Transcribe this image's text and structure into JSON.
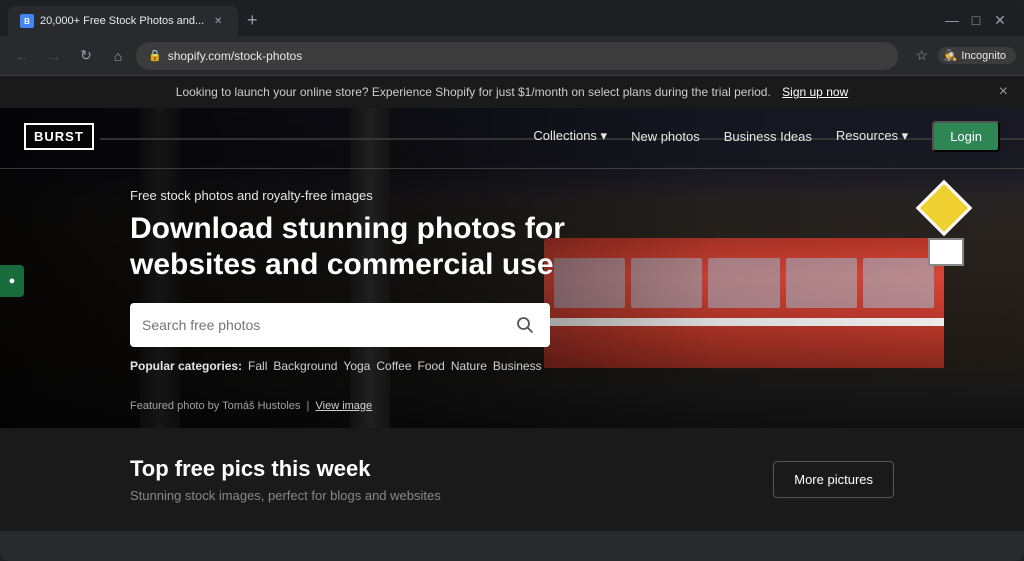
{
  "browser": {
    "tab_title": "20,000+ Free Stock Photos and...",
    "tab_new_label": "+",
    "url": "shopify.com/stock-photos",
    "window_controls": {
      "minimize": "—",
      "maximize": "□",
      "close": "✕"
    },
    "incognito_label": "Incognito"
  },
  "notification": {
    "text": "Looking to launch your online store? Experience Shopify for just $1/month on select plans during the trial period.",
    "link_text": "Sign up now",
    "close": "×"
  },
  "nav": {
    "logo": "BURST",
    "links": [
      {
        "label": "Collections",
        "has_dropdown": true
      },
      {
        "label": "New photos",
        "has_dropdown": false
      },
      {
        "label": "Business Ideas",
        "has_dropdown": false
      },
      {
        "label": "Resources",
        "has_dropdown": true
      }
    ],
    "login_label": "Login"
  },
  "hero": {
    "subtitle": "Free stock photos and royalty-free images",
    "title": "Download stunning photos for websites and commercial use",
    "search_placeholder": "Search free photos",
    "popular_label": "Popular categories:",
    "categories": [
      "Fall",
      "Background",
      "Yoga",
      "Coffee",
      "Food",
      "Nature",
      "Business"
    ],
    "photo_credit": "Featured photo by Tomáš Hustoles",
    "view_image_link": "View image"
  },
  "bottom": {
    "title": "Top free pics this week",
    "subtitle": "Stunning stock images, perfect for blogs and websites",
    "more_photos_label": "More pictures"
  },
  "feedback": {
    "label": "●"
  }
}
